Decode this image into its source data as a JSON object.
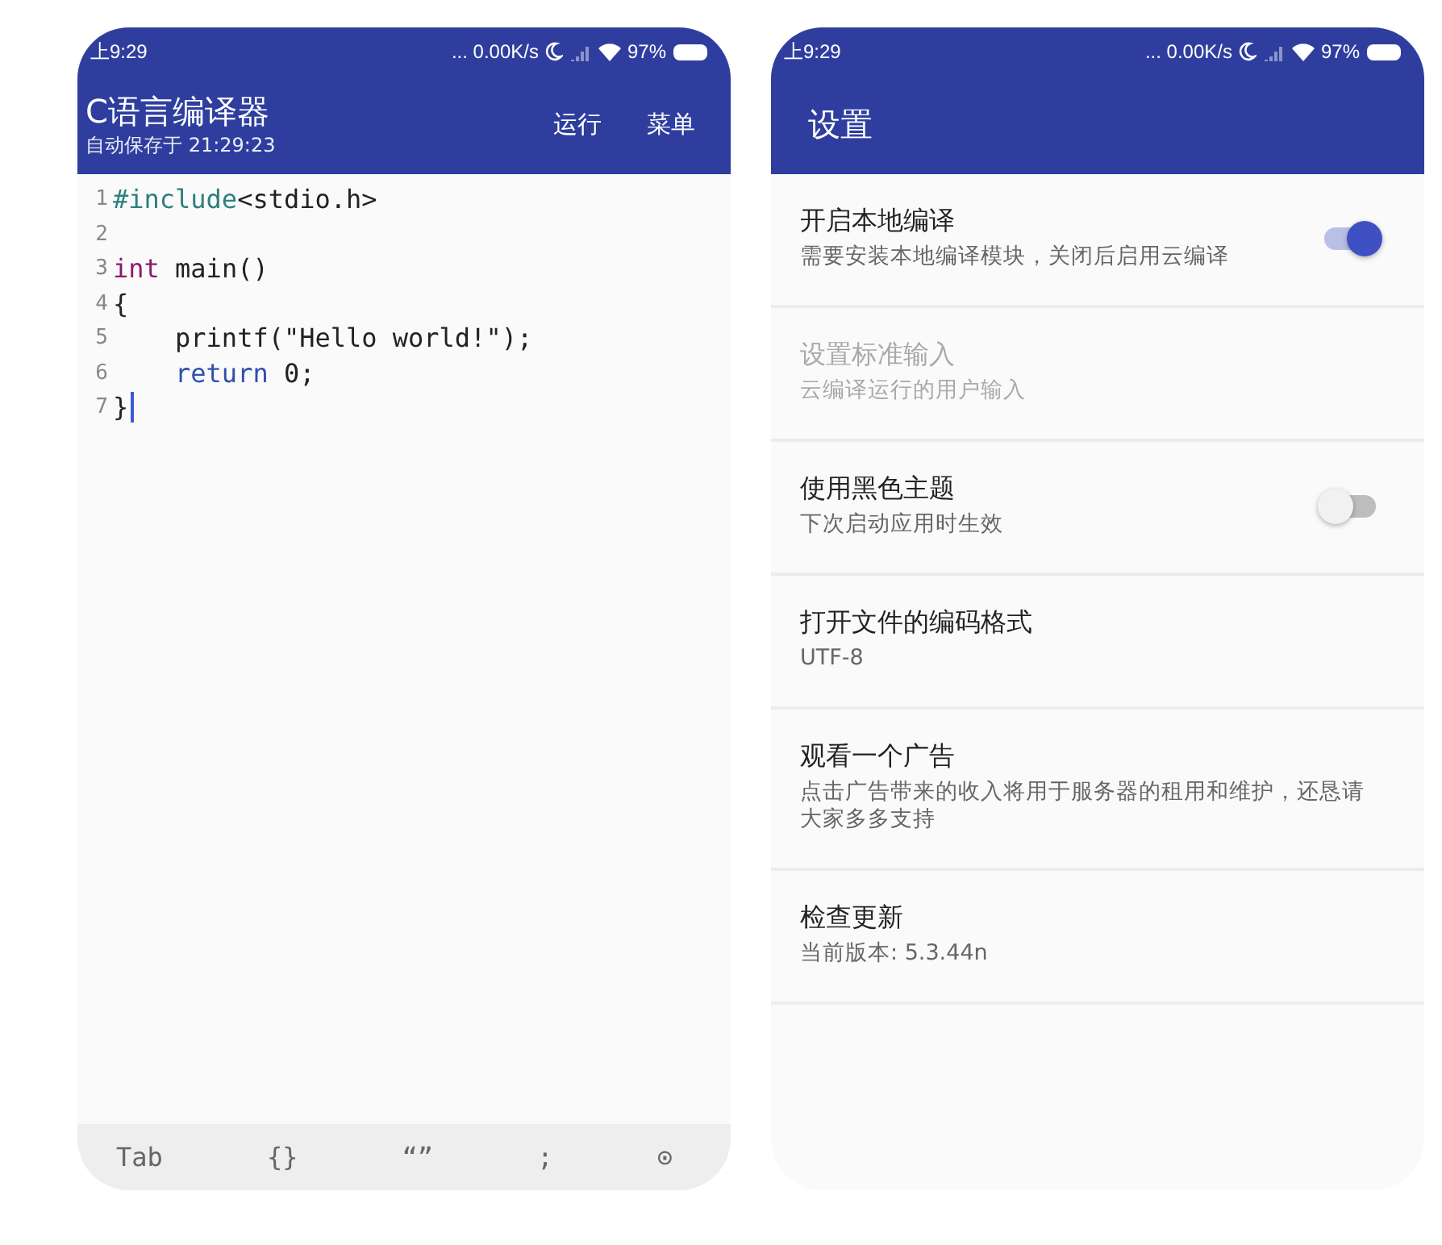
{
  "editor_screen": {
    "status_bar": {
      "time": "上9:29",
      "network_speed": "... 0.00K/s",
      "battery": "97%"
    },
    "app_bar": {
      "title": "C语言编译器",
      "subtitle": "自动保存于 21:29:23",
      "actions": [
        "运行",
        "菜单"
      ]
    },
    "code_lines": [
      {
        "number": "1",
        "cursor": false,
        "tokens": [
          {
            "kind": "preprocessor",
            "text": "#include"
          },
          {
            "kind": "plain",
            "text": "<stdio.h>"
          }
        ]
      },
      {
        "number": "2",
        "cursor": false
      },
      {
        "number": "3",
        "cursor": false,
        "tokens": [
          {
            "kind": "type",
            "text": "int"
          },
          {
            "kind": "plain",
            "text": " main()"
          }
        ]
      },
      {
        "number": "4",
        "cursor": false,
        "tokens": [
          {
            "kind": "plain",
            "text": "{"
          }
        ]
      },
      {
        "number": "5",
        "cursor": false,
        "tokens": [
          {
            "kind": "plain",
            "text": "    printf(\"Hello world!\");"
          }
        ]
      },
      {
        "number": "6",
        "cursor": false,
        "tokens": [
          {
            "kind": "keyword",
            "text": "    return"
          },
          {
            "kind": "plain",
            "text": " 0;"
          }
        ]
      },
      {
        "number": "7",
        "cursor": true,
        "tokens": [
          {
            "kind": "plain",
            "text": "}"
          }
        ]
      }
    ],
    "symbol_bar": [
      "Tab",
      "{}",
      "“”",
      ";",
      "⊙"
    ]
  },
  "settings_screen": {
    "status_bar": {
      "time": "上9:29",
      "network_speed": "... 0.00K/s",
      "battery": "97%"
    },
    "title": "设置",
    "items": [
      {
        "kind": "switch",
        "title": "开启本地编译",
        "summary": "需要安装本地编译模块，关闭后启用云编译",
        "disabled": false,
        "on": true
      },
      {
        "kind": "text",
        "title": "设置标准输入",
        "summary": "云编译运行的用户输入",
        "disabled": true
      },
      {
        "kind": "switch",
        "title": "使用黑色主题",
        "summary": "下次启动应用时生效",
        "disabled": false,
        "on": false
      },
      {
        "kind": "text",
        "title": "打开文件的编码格式",
        "summary": "UTF-8",
        "disabled": false
      },
      {
        "kind": "text",
        "title": "观看一个广告",
        "summary": "点击广告带来的收入将用于服务器的租用和维护，还恳请大家多多支持",
        "disabled": false
      },
      {
        "kind": "text",
        "title": "检查更新",
        "summary": "当前版本: 5.3.44n",
        "disabled": false
      }
    ]
  }
}
